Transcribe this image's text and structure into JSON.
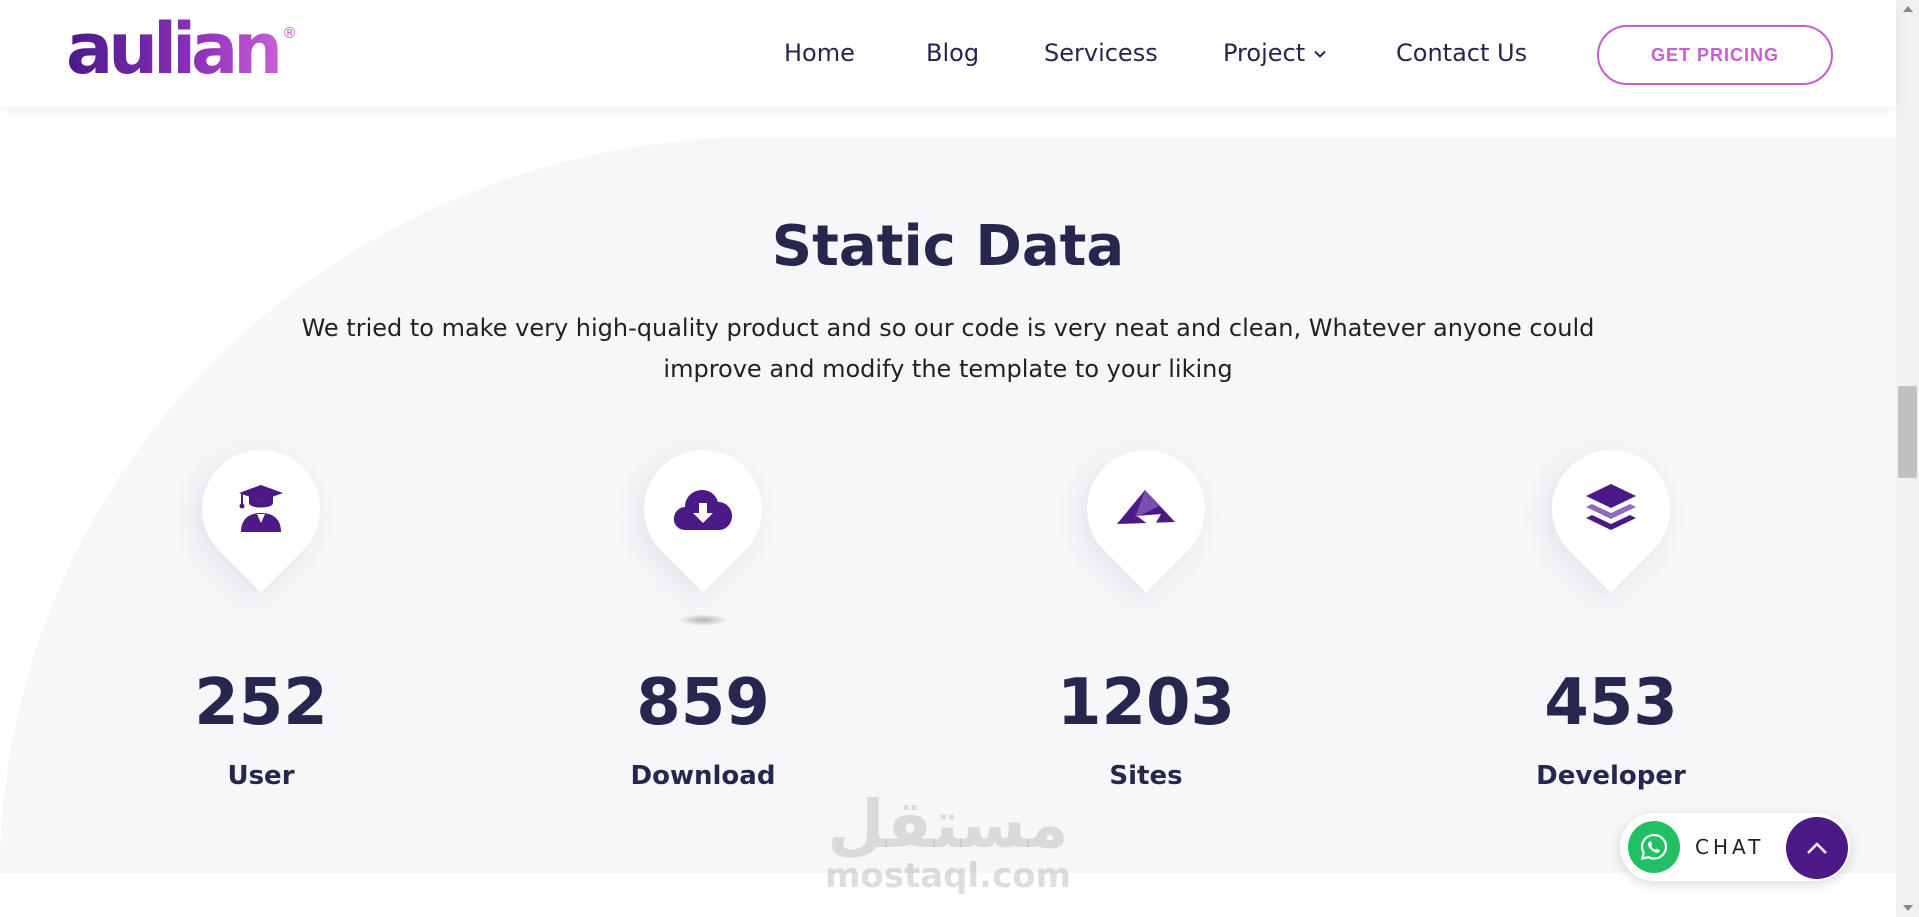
{
  "header": {
    "logo_text": "aulian",
    "logo_mark": "®",
    "nav": [
      {
        "label": "Home"
      },
      {
        "label": "Blog"
      },
      {
        "label": "Servicess"
      },
      {
        "label": "Project",
        "has_dropdown": true
      },
      {
        "label": "Contact Us"
      }
    ],
    "cta_label": "GET PRICING"
  },
  "section": {
    "title": "Static Data",
    "description": "We tried to make very high-quality product and so our code is very neat and clean, Whatever anyone could improve and modify the template to your liking"
  },
  "stats": [
    {
      "value": "252",
      "label": "User",
      "icon": "graduate-user-icon"
    },
    {
      "value": "859",
      "label": "Download",
      "icon": "cloud-download-icon"
    },
    {
      "value": "1203",
      "label": "Sites",
      "icon": "paper-plane-icon"
    },
    {
      "value": "453",
      "label": "Developer",
      "icon": "layers-icon"
    }
  ],
  "watermark": {
    "arabic": "مستقل",
    "latin": "mostaql.com"
  },
  "chat": {
    "label": "CHAT",
    "icon": "whatsapp-icon"
  },
  "colors": {
    "heading": "#26264f",
    "accent": "#c65ecf",
    "icon": "#4b1a86",
    "whatsapp": "#21c063",
    "section_bg": "#f7f7f9"
  }
}
